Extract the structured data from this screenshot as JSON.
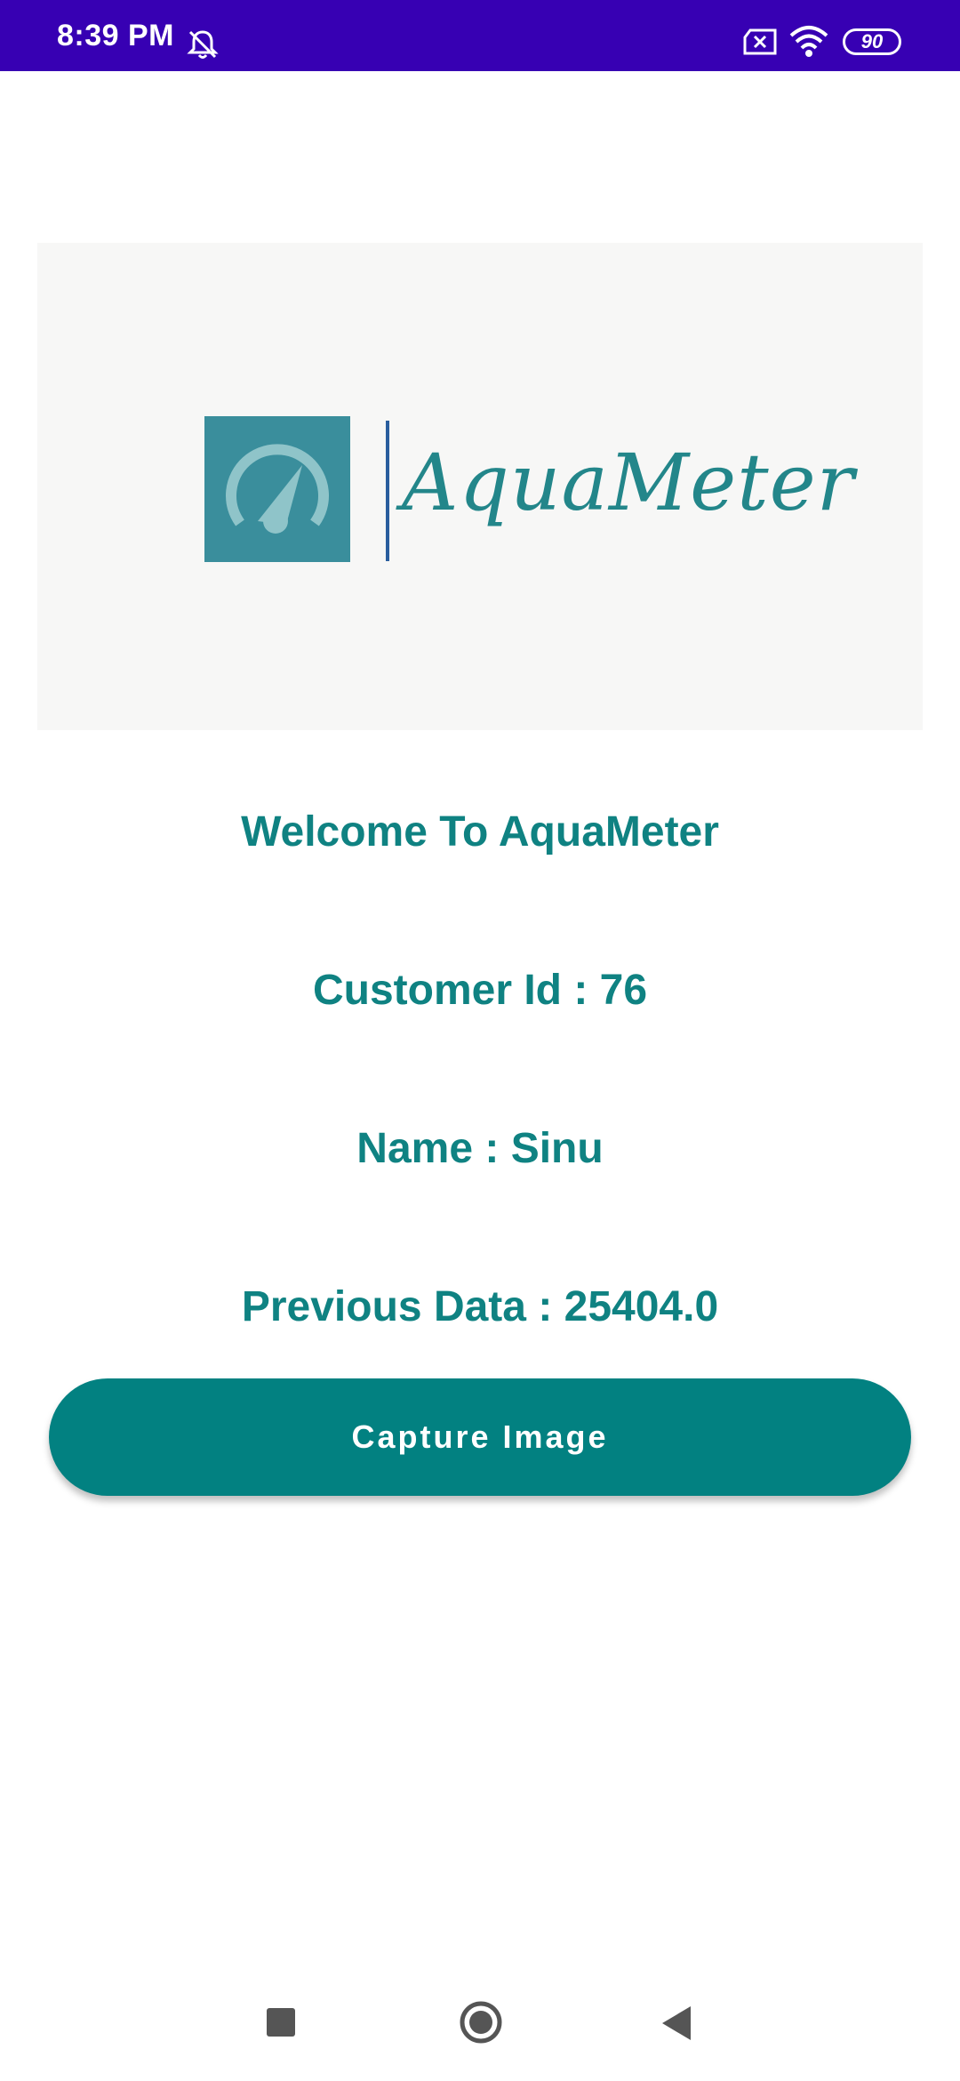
{
  "status_bar": {
    "time": "8:39 PM",
    "battery_level": "90",
    "icons": [
      "mute-bell-icon",
      "sim-off-icon",
      "wifi-icon",
      "battery-icon"
    ],
    "background_color": "#3700b3"
  },
  "banner": {
    "logo_text": "AquaMeter",
    "logo_icon": "speedometer-icon"
  },
  "main": {
    "welcome": "Welcome To AquaMeter",
    "customer_id": "Customer Id : 76",
    "name": "Name : Sinu",
    "previous_data": "Previous Data : 25404.0",
    "text_color": "#0f8282"
  },
  "actions": {
    "capture_label": "Capture Image",
    "button_color": "#028181"
  },
  "nav_bar": {
    "icons": [
      "recents-icon",
      "home-icon",
      "back-icon"
    ]
  }
}
